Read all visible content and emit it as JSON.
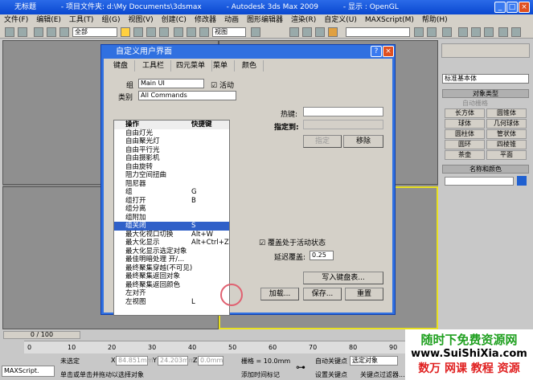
{
  "window": {
    "title": "无标题",
    "project": "- 项目文件夹: d:\\My Documents\\3dsmax",
    "app": "- Autodesk 3ds Max  2009",
    "display": "- 显示 : OpenGL"
  },
  "menu": [
    "文件(F)",
    "编辑(E)",
    "工具(T)",
    "组(G)",
    "视图(V)",
    "创建(C)",
    "修改器",
    "动画",
    "图形编辑器",
    "渲染(R)",
    "自定义(U)",
    "MAXScript(M)",
    "帮助(H)"
  ],
  "toolbar": {
    "selection_filter": "全部",
    "coord_system": "视图"
  },
  "dialog": {
    "title": "自定义用户界面",
    "tabs": [
      "键盘",
      "工具栏",
      "四元菜单",
      "菜单",
      "颜色"
    ],
    "group_label": "组",
    "group_value": "Main UI",
    "active_label": "活动",
    "category_label": "类别",
    "category_value": "All Commands",
    "col_action": "操作",
    "col_shortcut": "快捷键",
    "rows": [
      {
        "a": "自由灯光",
        "k": ""
      },
      {
        "a": "自由聚光灯",
        "k": ""
      },
      {
        "a": "自由平行光",
        "k": ""
      },
      {
        "a": "自由摄影机",
        "k": ""
      },
      {
        "a": "自由旋转",
        "k": ""
      },
      {
        "a": "阻力空间扭曲",
        "k": ""
      },
      {
        "a": "阻尼器",
        "k": ""
      },
      {
        "a": "组",
        "k": "G"
      },
      {
        "a": "组打开",
        "k": "B"
      },
      {
        "a": "组分离",
        "k": ""
      },
      {
        "a": "组附加",
        "k": ""
      },
      {
        "a": "组关闭",
        "k": "S"
      },
      {
        "a": "最大化视口切换",
        "k": "Alt+W"
      },
      {
        "a": "最大化显示",
        "k": "Alt+Ctrl+Z"
      },
      {
        "a": "最大化显示选定对象",
        "k": ""
      },
      {
        "a": "最佳明暗处理 开/...",
        "k": ""
      },
      {
        "a": "最终聚集穿越(不可见)",
        "k": ""
      },
      {
        "a": "最终聚集返回对象",
        "k": ""
      },
      {
        "a": "最终聚集返回颜色",
        "k": ""
      },
      {
        "a": "左对齐",
        "k": ""
      },
      {
        "a": "左视图",
        "k": "L"
      }
    ],
    "selected_row": 11,
    "hotkey_label": "热键:",
    "assigned_label": "指定到:",
    "assign_btn": "指定",
    "remove_btn": "移除",
    "overlay_label": "覆盖处于活动状态",
    "delay_label": "延迟覆盖:",
    "delay_value": "0.25",
    "write_btn": "写入键盘表...",
    "load_btn": "加载...",
    "save_btn": "保存...",
    "reset_btn": "重置"
  },
  "cmdpanel": {
    "dropdown": "标准基本体",
    "rollout1": "对象类型",
    "autogrid": "自动栅格",
    "buttons": [
      "长方体",
      "圆锥体",
      "球体",
      "几何球体",
      "圆柱体",
      "管状体",
      "圆环",
      "四棱锥",
      "茶壶",
      "平面"
    ],
    "rollout2": "名称和颜色",
    "color": "#2060d0"
  },
  "status": {
    "timeslider": "0 / 100",
    "ticks": [
      "0",
      "10",
      "20",
      "30",
      "40",
      "50",
      "60",
      "70",
      "80",
      "90"
    ],
    "selection": "未选定",
    "x_label": "X",
    "x": "84.851mm",
    "y_label": "Y",
    "y": "24.203mm",
    "z_label": "Z",
    "z": "0.0mm",
    "grid": "栅格 = 10.0mm",
    "autokey": "自动关键点",
    "selected_obj": "选定对象",
    "setkey": "设置关键点",
    "keyfilter": "关键点过滤器...",
    "prompt": "单击或单击并拖动以选择对象",
    "addtime": "添加时间标记",
    "maxscript": "MAXScript."
  },
  "watermark": {
    "line1": "随时下免费资源网",
    "line2": "www.SuiShiXia.com",
    "line3": "数万 网课 教程 资源"
  }
}
